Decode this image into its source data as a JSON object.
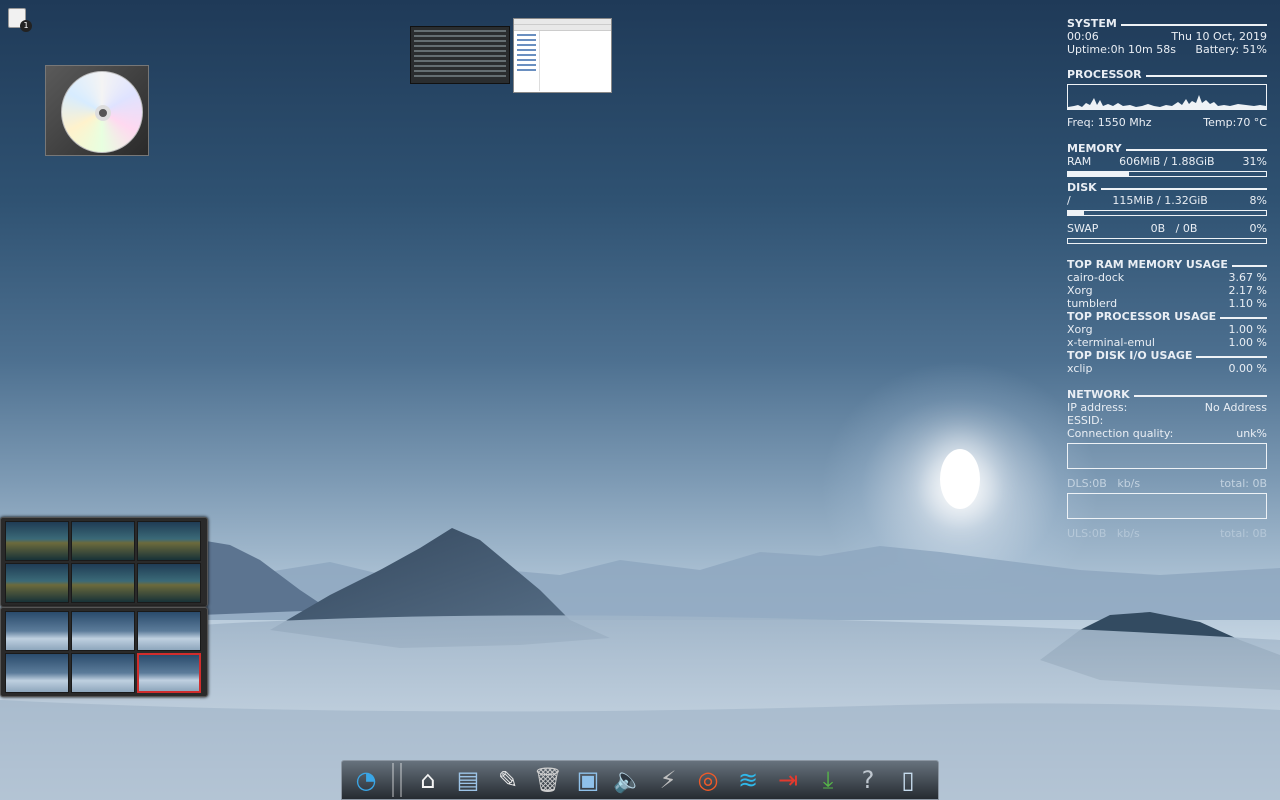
{
  "desktop": {
    "icons": [
      "notes-icon",
      "cd-icon"
    ],
    "notes_badge": "1"
  },
  "conky": {
    "system": {
      "heading": "SYSTEM",
      "time": "00:06",
      "date": "Thu 10 Oct, 2019",
      "uptime": "Uptime:0h 10m 58s",
      "battery": "Battery: 51%"
    },
    "processor": {
      "heading": "PROCESSOR",
      "freq": "Freq: 1550 Mhz",
      "temp": "Temp:70 °C"
    },
    "memory": {
      "heading": "MEMORY",
      "ram_label": "RAM",
      "ram_value": "606MiB / 1.88GiB",
      "ram_percent": "31%",
      "ram_fraction": 0.31
    },
    "disk": {
      "heading": "DISK",
      "root_label": "/",
      "root_value": "115MiB / 1.32GiB",
      "root_percent": "8%",
      "root_fraction": 0.08,
      "swap_label": "SWAP",
      "swap_value": "0B   / 0B",
      "swap_percent": "0%",
      "swap_fraction": 0
    },
    "top_ram": {
      "heading": "TOP RAM MEMORY USAGE",
      "rows": [
        {
          "name": "cairo-dock",
          "value": "3.67 %"
        },
        {
          "name": "Xorg",
          "value": "2.17 %"
        },
        {
          "name": "tumblerd",
          "value": "1.10 %"
        }
      ]
    },
    "top_cpu": {
      "heading": "TOP PROCESSOR USAGE",
      "rows": [
        {
          "name": "Xorg",
          "value": "1.00 %"
        },
        {
          "name": "x-terminal-emul",
          "value": "1.00 %"
        }
      ]
    },
    "top_disk": {
      "heading": "TOP DISK I/O USAGE",
      "rows": [
        {
          "name": "xclip",
          "value": "0.00 %"
        }
      ]
    },
    "network": {
      "heading": "NETWORK",
      "ip_label": "IP address:",
      "ip_value": "No Address",
      "essid_label": "ESSID:",
      "quality_label": "Connection quality:",
      "quality_value": "unk%",
      "dls_label": "DLS:0B   kb/s",
      "dls_total": "total: 0B",
      "uls_label": "ULS:0B   kb/s",
      "uls_total": "total: 0B"
    }
  },
  "dock": {
    "items": [
      {
        "name": "menu-icon",
        "glyph": "◔"
      },
      {
        "name": "home-folder-icon",
        "glyph": "⌂"
      },
      {
        "name": "file-manager-icon",
        "glyph": "▤"
      },
      {
        "name": "text-editor-icon",
        "glyph": "✎"
      },
      {
        "name": "trash-icon",
        "glyph": "🗑"
      },
      {
        "name": "image-viewer-icon",
        "glyph": "▣"
      },
      {
        "name": "volume-icon",
        "glyph": "🔈"
      },
      {
        "name": "power-icon",
        "glyph": "⚡"
      },
      {
        "name": "help-lifebuoy-icon",
        "glyph": "◎"
      },
      {
        "name": "wifi-icon",
        "glyph": "≋"
      },
      {
        "name": "logout-icon",
        "glyph": "⇥"
      },
      {
        "name": "download-icon",
        "glyph": "⤓"
      },
      {
        "name": "unknown-app-icon",
        "glyph": "?"
      },
      {
        "name": "window-icon",
        "glyph": "▯"
      }
    ]
  },
  "colors": {
    "panel_text": "#e9eef4",
    "active_workspace": "#d12d2d"
  }
}
